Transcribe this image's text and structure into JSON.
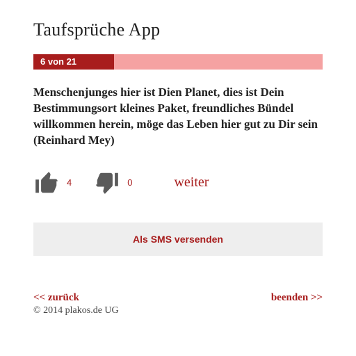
{
  "title": "Taufsprüche App",
  "progress": {
    "label": "6 von 21",
    "percent": 28
  },
  "quote": "Menschenjunges hier ist Dien Planet, dies ist Dein Bestimmungsort kleines Paket, freundliches Bündel willkommen herein, möge das Leben hier gut zu Dir sein (Reinhard Mey)",
  "votes": {
    "up": "4",
    "down": "0"
  },
  "actions": {
    "next": "weiter",
    "sms": "Als SMS versenden",
    "back": "<< zurück",
    "end": "beenden >>"
  },
  "copyright": "© 2014 plakos.de UG"
}
